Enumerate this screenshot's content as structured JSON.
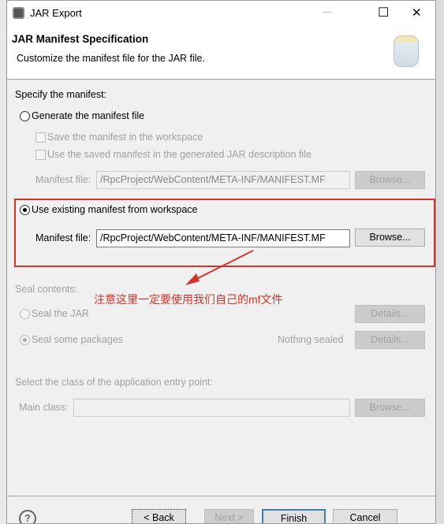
{
  "window": {
    "title": "JAR Export",
    "minimize": "—",
    "maximize": "☐",
    "close": "✕"
  },
  "header": {
    "title": "JAR Manifest Specification",
    "subtitle": "Customize the manifest file for the JAR file.",
    "icon": "jar-icon"
  },
  "manifest": {
    "label": "Specify the manifest:",
    "generate": {
      "label": "Generate the manifest file",
      "selected": false
    },
    "save_in_workspace": "Save the manifest in the workspace",
    "use_saved": "Use the saved manifest in the generated JAR description file",
    "gen_file_label": "Manifest file:",
    "gen_file_value": "/RpcProject/WebContent/META-INF/MANIFEST.MF",
    "gen_browse": "Browse...",
    "existing": {
      "label": "Use existing manifest from workspace",
      "selected": true
    },
    "file_label": "Manifest file:",
    "file_value": "/RpcProject/WebContent/META-INF/MANIFEST.MF",
    "browse": "Browse..."
  },
  "annotation": {
    "text": "注意这里一定要使用我们自己的mf文件",
    "color": "#d9342b"
  },
  "seal": {
    "label": "Seal contents:",
    "seal_jar": "Seal the JAR",
    "seal_packages": "Nothing sealed",
    "seal_some": "Seal some packages",
    "details": "Details..."
  },
  "entry": {
    "label": "Select the class of the application entry point:",
    "main_label": "Main class:",
    "main_value": "",
    "browse": "Browse..."
  },
  "footer": {
    "help": "?",
    "back": "< Back",
    "next": "Next >",
    "finish": "Finish",
    "cancel": "Cancel"
  }
}
